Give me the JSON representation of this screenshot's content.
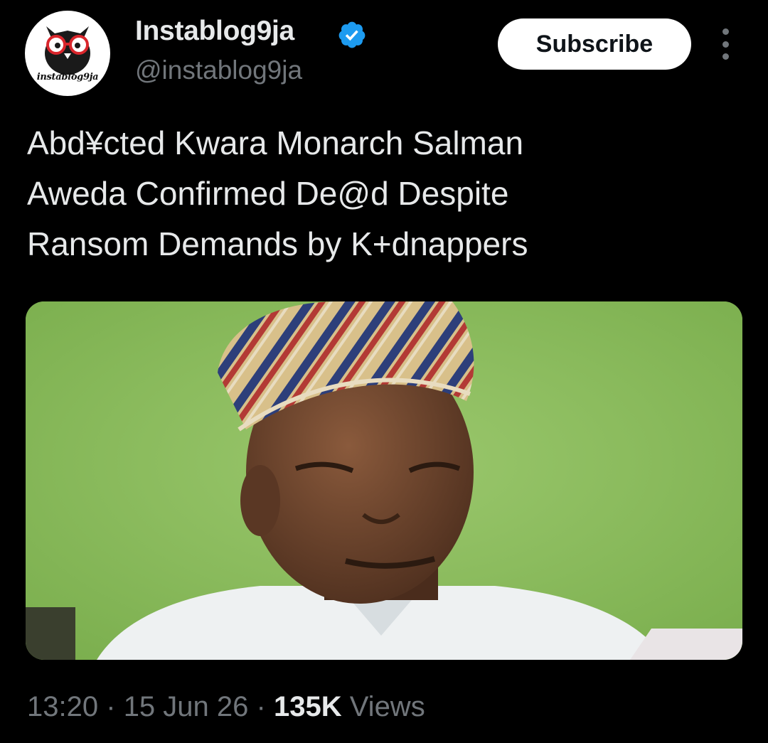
{
  "author": {
    "display_name": "Instablog9ja",
    "handle": "@instablog9ja",
    "avatar_label": "instablog9ja",
    "verified": true,
    "verified_icon": "verified-badge-icon",
    "verified_color": "#1d9bf0"
  },
  "actions": {
    "subscribe_label": "Subscribe",
    "more_icon": "more-vertical-icon"
  },
  "tweet": {
    "text_line_1": "Abd¥cted Kwara Monarch Salman",
    "text_line_2": "Aweda Confirmed De@d Despite",
    "text_line_3": "Ransom Demands by K+dnappers"
  },
  "meta": {
    "time": "13:20",
    "separator": "·",
    "date": "15 Jun 26",
    "views_count": "135K",
    "views_label": "Views"
  },
  "colors": {
    "background": "#000000",
    "text_primary": "#e7e9ea",
    "text_secondary": "#71767b",
    "media_background": "#8fc063"
  }
}
